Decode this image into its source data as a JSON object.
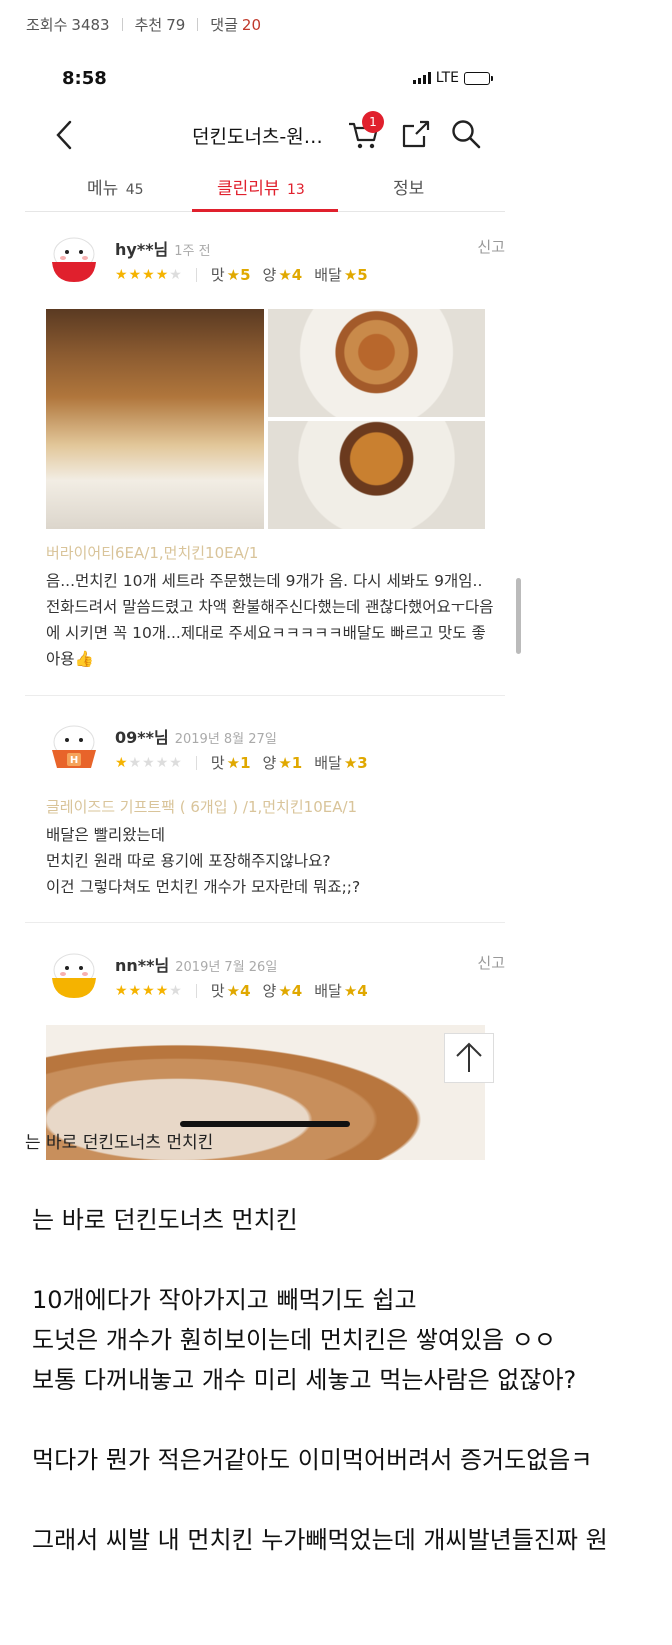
{
  "post_meta": {
    "views_label": "조회수",
    "views": "3483",
    "recommend_label": "추천",
    "recommend": "79",
    "comments_label": "댓글",
    "comments": "20"
  },
  "status_bar": {
    "time": "8:58",
    "network": "LTE"
  },
  "navbar": {
    "title": "던킨도너츠-원…",
    "cart_count": "1"
  },
  "tabs": [
    {
      "label": "메뉴",
      "count": "45"
    },
    {
      "label": "클린리뷰",
      "count": "13"
    },
    {
      "label": "정보",
      "count": ""
    }
  ],
  "reviews": [
    {
      "user": "hy**님",
      "date": "1주 전",
      "report": "신고",
      "stars": 4,
      "taste_label": "맛",
      "taste": "★5",
      "amount_label": "양",
      "amount": "★4",
      "delivery_label": "배달",
      "delivery": "★5",
      "menu": "버라이어티6EA/1,먼치킨10EA/1",
      "text": "음...먼치킨 10개 세트라 주문했는데 9개가 옴. 다시 세봐도 9개임.. 전화드려서 말씀드렸고 차액 환불해주신다했는데 괜찮다했어요ㅜ다음에 시키면 꼭 10개...제대로 주세요ㅋㅋㅋㅋㅋ배달도 빠르고 맛도 좋아용👍"
    },
    {
      "user": "09**님",
      "date": "2019년 8월 27일",
      "report": "",
      "stars": 1,
      "taste_label": "맛",
      "taste": "★1",
      "amount_label": "양",
      "amount": "★1",
      "delivery_label": "배달",
      "delivery": "★3",
      "menu": "글레이즈드 기프트팩 ( 6개입 ) /1,먼치킨10EA/1",
      "lines": [
        "배달은 빨리왔는데",
        "먼치킨 원래 따로 용기에 포장해주지않나요?",
        "이건 그렇다쳐도 먼치킨 개수가 모자란데 뭐죠;;?"
      ]
    },
    {
      "user": "nn**님",
      "date": "2019년 7월 26일",
      "report": "신고",
      "stars": 4,
      "taste_label": "맛",
      "taste": "★4",
      "amount_label": "양",
      "amount": "★4",
      "delivery_label": "배달",
      "delivery": "★4"
    }
  ],
  "caption": "는 바로 던킨도너츠 먼치킨",
  "body_lines": [
    "는 바로 던킨도너츠 먼치킨",
    "",
    "10개에다가 작아가지고 빼먹기도 쉽고",
    "도넛은 개수가 훤히보이는데 먼치킨은 쌓여있음 ㅇㅇ",
    "보통 다꺼내놓고 개수 미리 세놓고 먹는사람은 없잖아?",
    "",
    "먹다가 뭔가 적은거같아도 이미먹어버려서 증거도없음ㅋ",
    "",
    "그래서 씨발 내 먼치킨 누가빼먹었는데 개씨발년들진짜 원"
  ],
  "colors": {
    "accent": "#e0202d",
    "star": "#f5b300",
    "menu_text": "#d9c49a"
  }
}
